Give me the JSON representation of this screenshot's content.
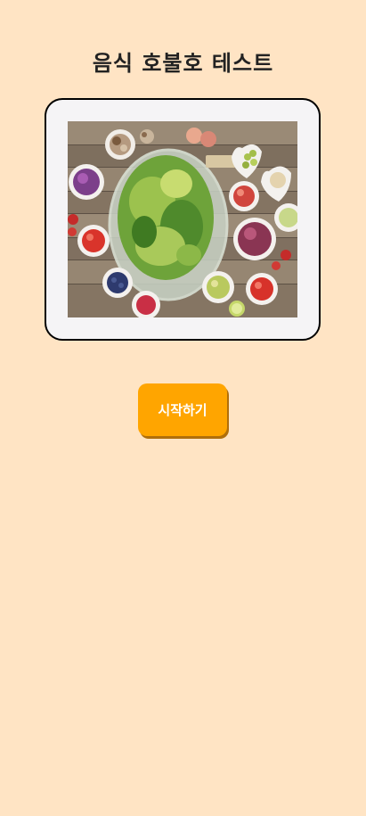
{
  "header": {
    "title": "음식 호불호 테스트"
  },
  "hero": {
    "image_subject": "salad-bowls-on-wooden-table-photo"
  },
  "actions": {
    "start_label": "시작하기"
  },
  "colors": {
    "background": "#ffe4c4",
    "button": "#ffa500",
    "button_text": "#ffffff",
    "frame_border": "#000000",
    "frame_fill": "#f5f4f6"
  }
}
